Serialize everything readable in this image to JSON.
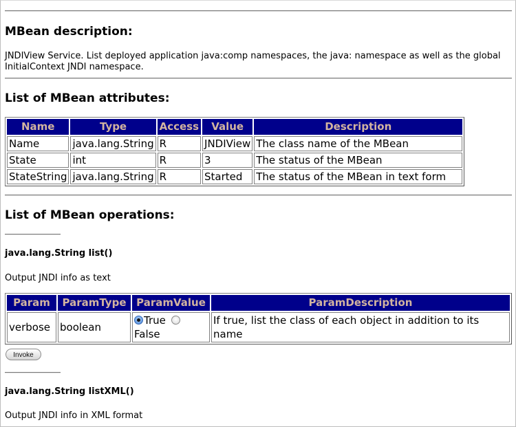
{
  "description_section": {
    "heading": "MBean description:",
    "text": "JNDIView Service. List deployed application java:comp namespaces, the java: namespace as well as the global InitialContext JNDI namespace."
  },
  "attributes_section": {
    "heading": "List of MBean attributes:",
    "columns": [
      "Name",
      "Type",
      "Access",
      "Value",
      "Description"
    ],
    "rows": [
      [
        "Name",
        "java.lang.String",
        "R",
        "JNDIView",
        "The class name of the MBean"
      ],
      [
        "State",
        "int",
        "R",
        "3",
        "The status of the MBean"
      ],
      [
        "StateString",
        "java.lang.String",
        "R",
        "Started",
        "The status of the MBean in text form"
      ]
    ]
  },
  "operations_section": {
    "heading": "List of MBean operations:",
    "operations": [
      {
        "signature": "java.lang.String list()",
        "description": "Output JNDI info as text",
        "param_columns": [
          "Param",
          "ParamType",
          "ParamValue",
          "ParamDescription"
        ],
        "params": [
          {
            "name": "verbose",
            "type": "boolean",
            "options": [
              {
                "label": "True",
                "checked": true
              },
              {
                "label": "False",
                "checked": false
              }
            ],
            "description": "If true, list the class of each object in addition to its name"
          }
        ],
        "invoke_label": "Invoke"
      },
      {
        "signature": "java.lang.String listXML()",
        "description": "Output JNDI info in XML format"
      }
    ]
  },
  "colors": {
    "table_header_bg": "#00008b",
    "table_header_text": "#d2b4a0"
  }
}
